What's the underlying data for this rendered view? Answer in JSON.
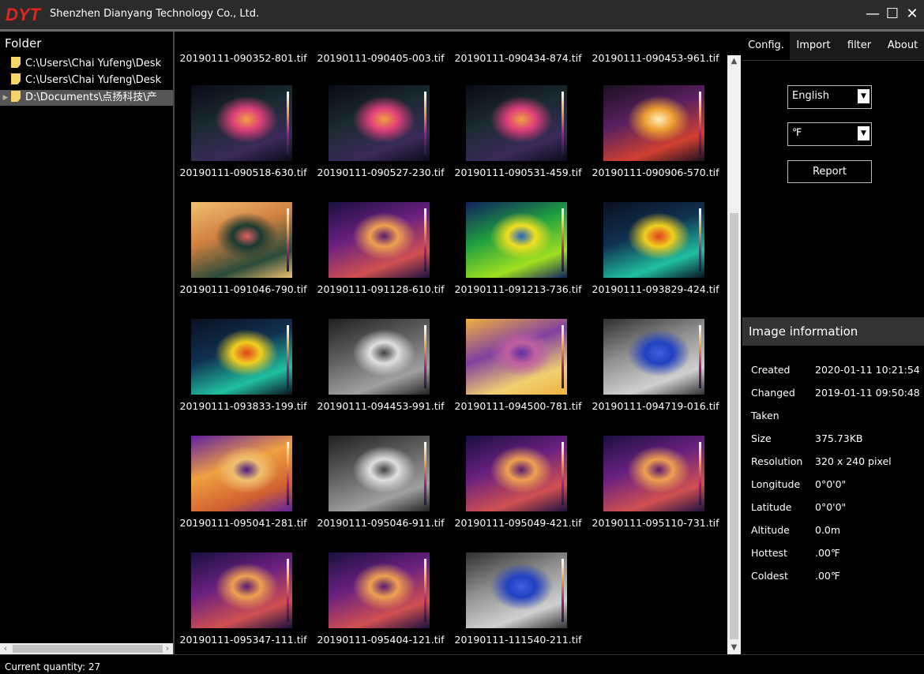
{
  "window": {
    "title": "Shenzhen Dianyang Technology Co., Ltd.",
    "logo_text": "DYT"
  },
  "window_controls": {
    "minimize": "—",
    "maximize": "☐",
    "close": "✕"
  },
  "folder_panel": {
    "header": "Folder",
    "items": [
      {
        "label": "C:\\Users\\Chai Yufeng\\Desk",
        "selected": false,
        "expandable": false
      },
      {
        "label": "C:\\Users\\Chai Yufeng\\Desk",
        "selected": false,
        "expandable": false
      },
      {
        "label": "D:\\Documents\\点扬科技\\产",
        "selected": true,
        "expandable": true
      }
    ]
  },
  "top_row_captions": [
    "20190111-090352-801.tif",
    "20190111-090405-003.tif",
    "20190111-090434-874.tif",
    "20190111-090453-961.tif"
  ],
  "thumbnails": [
    {
      "name": "20190111-090518-630.tif",
      "palette": "ironbow-dark"
    },
    {
      "name": "20190111-090527-230.tif",
      "palette": "ironbow-dark"
    },
    {
      "name": "20190111-090531-459.tif",
      "palette": "ironbow-dark"
    },
    {
      "name": "20190111-090906-570.tif",
      "palette": "ironbow-hot"
    },
    {
      "name": "20190111-091046-790.tif",
      "palette": "ironbow-green"
    },
    {
      "name": "20190111-091128-610.tif",
      "palette": "ironbow"
    },
    {
      "name": "20190111-091213-736.tif",
      "palette": "rainbow"
    },
    {
      "name": "20190111-093829-424.tif",
      "palette": "rainbow-dark"
    },
    {
      "name": "20190111-093833-199.tif",
      "palette": "rainbow-dark"
    },
    {
      "name": "20190111-094453-991.tif",
      "palette": "grayscale"
    },
    {
      "name": "20190111-094500-781.tif",
      "palette": "ironbow-checker"
    },
    {
      "name": "20190111-094719-016.tif",
      "palette": "gray-blue"
    },
    {
      "name": "20190111-095041-281.tif",
      "palette": "ironbow-bright"
    },
    {
      "name": "20190111-095046-911.tif",
      "palette": "grayscale"
    },
    {
      "name": "20190111-095049-421.tif",
      "palette": "ironbow"
    },
    {
      "name": "20190111-095110-731.tif",
      "palette": "ironbow"
    },
    {
      "name": "20190111-095347-111.tif",
      "palette": "ironbow"
    },
    {
      "name": "20190111-095404-121.tif",
      "palette": "ironbow"
    },
    {
      "name": "20190111-111540-211.tif",
      "palette": "gray-blue"
    }
  ],
  "tabs": [
    {
      "label": "Config.",
      "active": true
    },
    {
      "label": "Import",
      "active": false
    },
    {
      "label": "filter",
      "active": false
    },
    {
      "label": "About",
      "active": false
    }
  ],
  "config": {
    "language": "English",
    "unit": "℉",
    "report_button": "Report"
  },
  "image_info": {
    "header": "Image information",
    "rows": [
      {
        "key": "Created",
        "value": "2020-01-11 10:21:54"
      },
      {
        "key": "Changed",
        "value": "2019-01-11 09:50:48"
      },
      {
        "key": "Taken",
        "value": ""
      },
      {
        "key": "Size",
        "value": "375.73KB"
      },
      {
        "key": "Resolution",
        "value": "320 x 240 pixel"
      },
      {
        "key": "Longitude",
        "value": "0°0'0\""
      },
      {
        "key": "Latitude",
        "value": "0°0'0\""
      },
      {
        "key": "Altitude",
        "value": "0.0m"
      },
      {
        "key": "Hottest",
        "value": ".00℉"
      },
      {
        "key": "Coldest",
        "value": ".00℉"
      }
    ]
  },
  "status": {
    "text": "Current quantity:  27"
  }
}
